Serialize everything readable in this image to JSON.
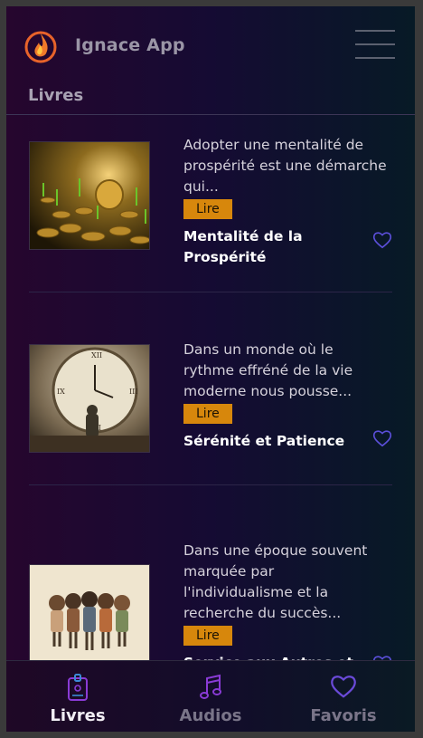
{
  "header": {
    "app_title": "Ignace App",
    "logo_icon": "flame-logo-icon",
    "menu_icon": "hamburger-menu-icon"
  },
  "section": {
    "title": "Livres"
  },
  "books": [
    {
      "description": "Adopter une mentalité de prospérité est une démarche qui...",
      "read_label": "Lire",
      "title": "Mentalité de la Prospérité",
      "image": "coins-and-plants-illustration",
      "favorite_icon": "heart-outline-icon"
    },
    {
      "description": "Dans un monde où le rythme effréné de la vie moderne nous pousse...",
      "read_label": "Lire",
      "title": "Sérénité et Patience",
      "image": "man-facing-giant-clock-illustration",
      "favorite_icon": "heart-outline-icon"
    },
    {
      "description": "Dans une époque souvent marquée par l'individualisme et la recherche du succès...",
      "read_label": "Lire",
      "title": "Service aux Autres et",
      "image": "group-of-children-illustration",
      "favorite_icon": "heart-outline-icon"
    }
  ],
  "nav": {
    "items": [
      {
        "label": "Livres",
        "icon": "book-badge-icon",
        "active": true
      },
      {
        "label": "Audios",
        "icon": "music-note-icon",
        "active": false
      },
      {
        "label": "Favoris",
        "icon": "heart-icon",
        "active": false
      }
    ]
  },
  "colors": {
    "accent_orange": "#d7870c",
    "nav_active_icon": "#8a3bd6",
    "favorite_icon": "#5b4fd9"
  }
}
